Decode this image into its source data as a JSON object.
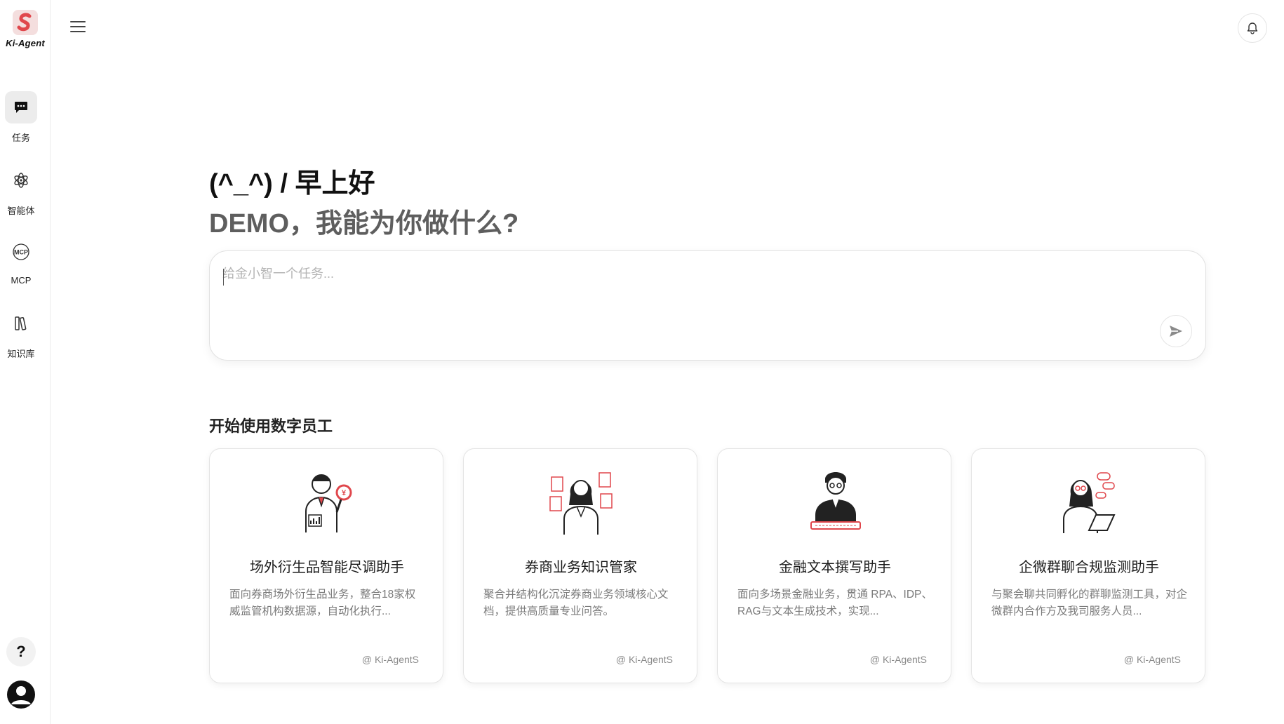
{
  "app": {
    "brand": "Ki-Agent",
    "brand_color": "#e0474c"
  },
  "sidebar": {
    "items": [
      {
        "label": "任务",
        "icon": "chat-bubble-icon",
        "active": true
      },
      {
        "label": "智能体",
        "icon": "atom-icon",
        "active": false
      },
      {
        "label": "MCP",
        "icon": "mcp-icon",
        "active": false
      },
      {
        "label": "知识库",
        "icon": "books-icon",
        "active": false
      }
    ],
    "help_label": "?",
    "help_icon": "help-icon",
    "avatar_icon": "user-avatar-icon"
  },
  "topbar": {
    "menu_icon": "hamburger-menu-icon",
    "bell_icon": "bell-icon"
  },
  "main": {
    "greeting": "(^_^) / 早上好",
    "subtitle": "DEMO，我能为你做什么?",
    "task_input": {
      "placeholder": "给金小智一个任务...",
      "value": ""
    },
    "send_icon": "send-icon",
    "section_title": "开始使用数字员工",
    "cards": [
      {
        "title": "场外衍生品智能尽调助手",
        "desc": "面向券商场外衍生品业务，整合18家权威监管机构数据源，自动化执行...",
        "source": "@ Ki-AgentS",
        "illustration": "analyst-with-magnifier-illustration"
      },
      {
        "title": "券商业务知识管家",
        "desc": "聚合并结构化沉淀券商业务领域核心文档，提供高质量专业问答。",
        "source": "@ Ki-AgentS",
        "illustration": "woman-with-documents-illustration"
      },
      {
        "title": "金融文本撰写助手",
        "desc": "面向多场景金融业务，贯通 RPA、IDP、RAG与文本生成技术，实现...",
        "source": "@ Ki-AgentS",
        "illustration": "man-typing-keyboard-illustration"
      },
      {
        "title": "企微群聊合规监测助手",
        "desc": "与聚会聊共同孵化的群聊监测工具，对企微群内合作方及我司服务人员...",
        "source": "@ Ki-AgentS",
        "illustration": "woman-with-laptop-chat-illustration"
      }
    ]
  }
}
